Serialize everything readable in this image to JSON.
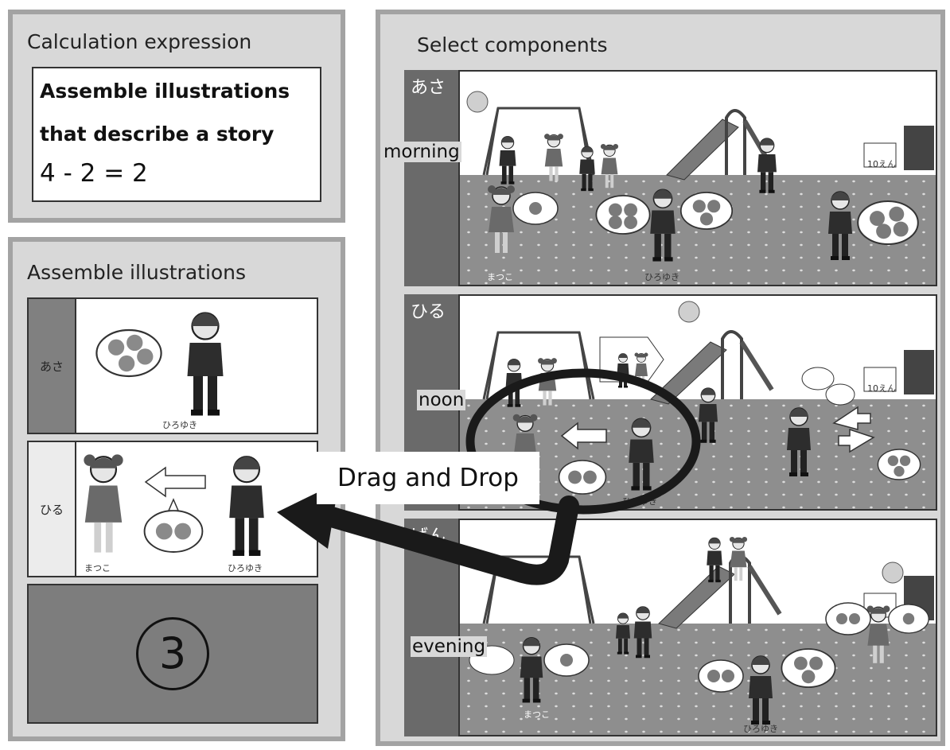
{
  "calculation": {
    "title": "Calculation expression",
    "story_line_1": "Assemble illustrations",
    "story_line_2": "that describe a story",
    "expression": "4 - 2 = 2"
  },
  "assemble": {
    "title": "Assemble illustrations",
    "slots": [
      {
        "tag": "あさ",
        "caption_1": "ひろゆき"
      },
      {
        "tag": "ひる",
        "caption_1": "まつこ",
        "caption_2": "ひろゆき"
      },
      {
        "number": "3"
      }
    ]
  },
  "select": {
    "title": "Select components",
    "strips": [
      {
        "tag": "あさ",
        "label": "morning",
        "caption_1": "まつこ",
        "caption_2": "ひろゆき",
        "sign": "10えん"
      },
      {
        "tag": "ひる",
        "label": "noon",
        "caption_2": "ひろゆき",
        "sign": "10えん"
      },
      {
        "tag": "ばん",
        "label": "evening",
        "caption_1": "まつこ",
        "caption_2": "ひろゆき"
      }
    ]
  },
  "instruction": {
    "drag_label": "Drag and Drop"
  },
  "colors": {
    "panel_bg": "#d8d8d8",
    "panel_border": "#a3a3a3",
    "morning_tag": "#808080",
    "empty_slot": "#7d7d7d",
    "arrow": "#1a1a1a"
  }
}
